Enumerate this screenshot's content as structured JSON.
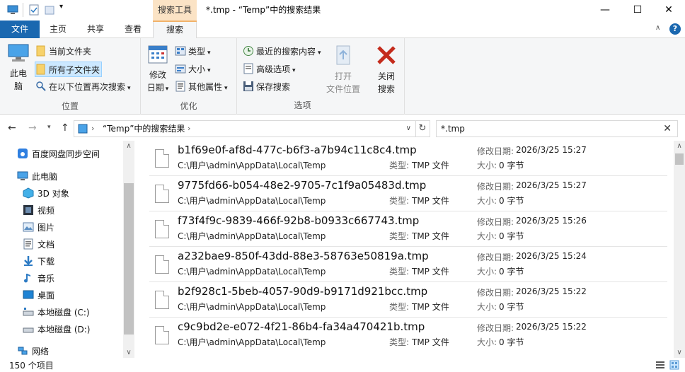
{
  "window": {
    "context_tab": "搜索工具",
    "title": "*.tmp - “Temp”中的搜索结果"
  },
  "tabs": {
    "file": "文件",
    "home": "主页",
    "share": "共享",
    "view": "查看",
    "search": "搜索"
  },
  "ribbon": {
    "location": {
      "this_pc_line1": "此电",
      "this_pc_line2": "脑",
      "current_folder": "当前文件夹",
      "all_subfolders": "所有子文件夹",
      "search_again": "在以下位置再次搜索",
      "label": "位置"
    },
    "refine": {
      "modified_line1": "修改",
      "modified_line2": "日期",
      "kind": "类型",
      "size": "大小",
      "other": "其他属性",
      "label": "优化"
    },
    "options": {
      "recent": "最近的搜索内容",
      "advanced": "高级选项",
      "save": "保存搜索",
      "open_loc_line1": "打开",
      "open_loc_line2": "文件位置",
      "close_line1": "关闭",
      "close_line2": "搜索",
      "label": "选项"
    }
  },
  "address": {
    "path": "“Temp”中的搜索结果"
  },
  "search": {
    "query": "*.tmp"
  },
  "nav": {
    "baidu": "百度网盘同步空间",
    "this_pc": "此电脑",
    "objects3d": "3D 对象",
    "videos": "视频",
    "pictures": "图片",
    "documents": "文档",
    "downloads": "下载",
    "music": "音乐",
    "desktop": "桌面",
    "disk_c": "本地磁盘 (C:)",
    "disk_d": "本地磁盘 (D:)",
    "network": "网络"
  },
  "labels": {
    "type": "类型:",
    "modified": "修改日期:",
    "size": "大小:"
  },
  "files": [
    {
      "name": "b1f69e0f-af8d-477c-b6f3-a7b94c11c8c4.tmp",
      "path": "C:\\用户\\admin\\AppData\\Local\\Temp",
      "type": "TMP 文件",
      "modified": "2026/3/25 15:27",
      "size": "0 字节"
    },
    {
      "name": "9775fd66-b054-48e2-9705-7c1f9a05483d.tmp",
      "path": "C:\\用户\\admin\\AppData\\Local\\Temp",
      "type": "TMP 文件",
      "modified": "2026/3/25 15:27",
      "size": "0 字节"
    },
    {
      "name": "f73f4f9c-9839-466f-92b8-b0933c667743.tmp",
      "path": "C:\\用户\\admin\\AppData\\Local\\Temp",
      "type": "TMP 文件",
      "modified": "2026/3/25 15:26",
      "size": "0 字节"
    },
    {
      "name": "a232bae9-850f-43dd-88e3-58763e50819a.tmp",
      "path": "C:\\用户\\admin\\AppData\\Local\\Temp",
      "type": "TMP 文件",
      "modified": "2026/3/25 15:24",
      "size": "0 字节"
    },
    {
      "name": "b2f928c1-5beb-4057-90d9-b9171d921bcc.tmp",
      "path": "C:\\用户\\admin\\AppData\\Local\\Temp",
      "type": "TMP 文件",
      "modified": "2026/3/25 15:22",
      "size": "0 字节"
    },
    {
      "name": "c9c9bd2e-e072-4f21-86b4-fa34a470421b.tmp",
      "path": "C:\\用户\\admin\\AppData\\Local\\Temp",
      "type": "TMP 文件",
      "modified": "2026/3/25 15:22",
      "size": "0 字节"
    }
  ],
  "status": {
    "count": "150 个项目"
  },
  "colors": {
    "file_tab": "#1a68b0",
    "context_tab": "#fbe3c5",
    "selection": "#cce8ff",
    "close_x": "#c42b1c"
  },
  "icons": [
    "properties-icon",
    "new-folder-icon",
    "minimize-icon",
    "maximize-icon",
    "close-icon",
    "help-icon",
    "computer-icon",
    "folder-icon",
    "calendar-icon",
    "clock-icon",
    "save-icon",
    "close-search-icon",
    "back-icon",
    "forward-icon",
    "up-icon",
    "refresh-icon",
    "cloud-icon",
    "file-icon"
  ]
}
